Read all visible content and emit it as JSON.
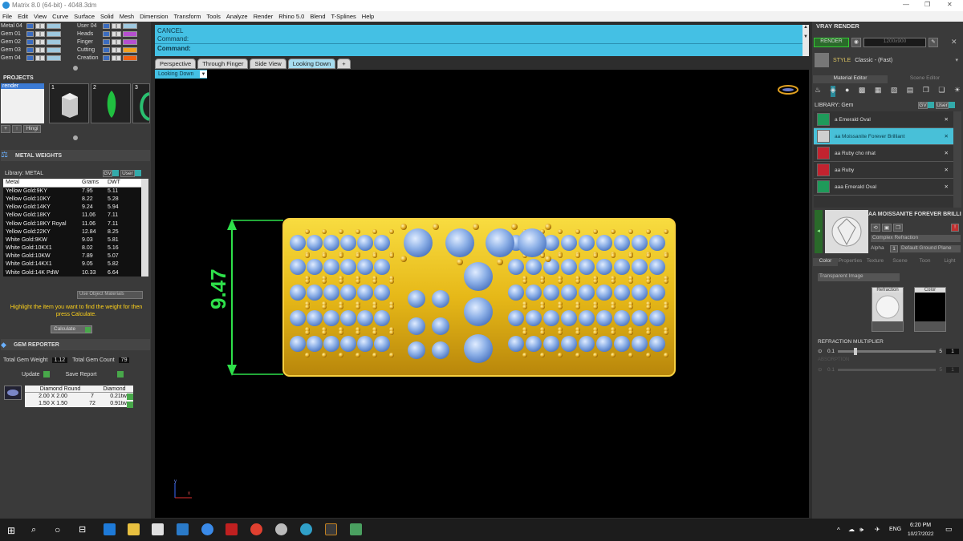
{
  "window": {
    "title": "Matrix 8.0 (64-bit) - 4048.3dm"
  },
  "menu": [
    "File",
    "Edit",
    "View",
    "Curve",
    "Surface",
    "Solid",
    "Mesh",
    "Dimension",
    "Transform",
    "Tools",
    "Analyze",
    "Render",
    "Rhino 5.0",
    "Blend",
    "T-Splines",
    "Help"
  ],
  "layers_left": [
    {
      "label": "Metal 04",
      "color": "#9fc9e0"
    },
    {
      "label": "Gem 01",
      "color": "#9fc9e0"
    },
    {
      "label": "Gem 02",
      "color": "#9fc9e0"
    },
    {
      "label": "Gem 03",
      "color": "#9fc9e0"
    },
    {
      "label": "Gem 04",
      "color": "#9fc9e0"
    }
  ],
  "layers_right": [
    {
      "label": "User 04",
      "color": "#9fc9e0"
    },
    {
      "label": "Heads",
      "color": "#b64fd0"
    },
    {
      "label": "Finger",
      "color": "#b64fd0"
    },
    {
      "label": "Cutting",
      "color": "#f0a020"
    },
    {
      "label": "Creation",
      "color": "#f06010"
    }
  ],
  "projects": {
    "header": "PROJECTS",
    "item": "render",
    "nums": [
      "1",
      "2",
      "3"
    ],
    "hinge": "Hingi"
  },
  "metal_weights": {
    "header": "METAL WEIGHTS",
    "library": "Library: METAL",
    "tag_gv": "GV",
    "tag_user": "User",
    "columns": [
      "Metal",
      "Grams",
      "DWT"
    ],
    "rows": [
      [
        "Yellow Gold:9KY",
        "7.95",
        "5.11"
      ],
      [
        "Yellow Gold:10KY",
        "8.22",
        "5.28"
      ],
      [
        "Yellow Gold:14KY",
        "9.24",
        "5.94"
      ],
      [
        "Yellow Gold:18KY",
        "11.06",
        "7.11"
      ],
      [
        "Yellow Gold:18KY Royal",
        "11.06",
        "7.11"
      ],
      [
        "Yellow Gold:22KY",
        "12.84",
        "8.25"
      ],
      [
        "White Gold:9KW",
        "9.03",
        "5.81"
      ],
      [
        "White Gold:10KX1",
        "8.02",
        "5.16"
      ],
      [
        "White Gold:10KW",
        "7.89",
        "5.07"
      ],
      [
        "White Gold:14KX1",
        "9.05",
        "5.82"
      ],
      [
        "White Gold:14K PdW",
        "10.33",
        "6.64"
      ]
    ],
    "use_object_materials": "Use Object Materials",
    "hint": "Highlight the item you want to find the weight for then press Calculate.",
    "calculate": "Calculate"
  },
  "gem_reporter": {
    "header": "GEM REPORTER",
    "total_weight_label": "Total Gem Weight",
    "total_weight": "1.12",
    "total_count_label": "Total Gem Count",
    "total_count": "79",
    "update": "Update",
    "save_report": "Save Report",
    "columns": [
      "Diamond Round",
      "Diamond"
    ],
    "rows": [
      [
        "2.00 X 2.00",
        "7",
        "0.21tw"
      ],
      [
        "1.50 X 1.50",
        "72",
        "0.91tw"
      ]
    ]
  },
  "command": {
    "line1": "CANCEL",
    "line2": "Command:",
    "line3": "Command:"
  },
  "tabs": [
    "Perspective",
    "Through Finger",
    "Side View",
    "Looking Down"
  ],
  "tab_add": "+",
  "viewport": {
    "label": "Looking Down",
    "dimension": "9.47",
    "axis_y": "y",
    "axis_x": "x"
  },
  "vray": {
    "header": "VRAY RENDER",
    "render": "RENDER",
    "size": "1200x900",
    "style_label": "STYLE",
    "style_value": "Classic - (Fast)",
    "tabs": [
      "Material Editor",
      "Scene Editor"
    ],
    "library": "LIBRARY: Gem",
    "tag_gv": "GV",
    "tag_user": "User",
    "materials": [
      {
        "name": "a Emerald Oval",
        "color": "#1f9a5a"
      },
      {
        "name": "aa Moissanite Forever Brilliant",
        "color": "#cfcfcf"
      },
      {
        "name": "aa Ruby cho nhat",
        "color": "#c2232f"
      },
      {
        "name": "aa Ruby",
        "color": "#c2232f"
      },
      {
        "name": "aaa Emerald Oval",
        "color": "#1f9a5a"
      }
    ],
    "selected_material": "AA MOISSANITE FOREVER BRILLIANT",
    "complex_refraction": "Complex Refraction",
    "alpha": "Alpha",
    "alpha_value": "1",
    "ground": "Default Ground Plane",
    "prop_tabs": [
      "Color",
      "Properties",
      "Texture",
      "Scene",
      "Toon",
      "Light"
    ],
    "transparent": "Transparent Image",
    "refraction_label": "Refraction",
    "color_label": "Color",
    "refraction_multiplier": "REFRACTION MULTIPLIER",
    "rm_min": "0.1",
    "rm_max": "5",
    "rm_value": "1",
    "rm2_label": "ABSORPTION",
    "rm2_min": "0.1",
    "rm2_max": "5",
    "rm2_value": "1"
  },
  "taskbar": {
    "time": "6:20 PM",
    "date": "10/27/2022",
    "lang": "ENG"
  }
}
